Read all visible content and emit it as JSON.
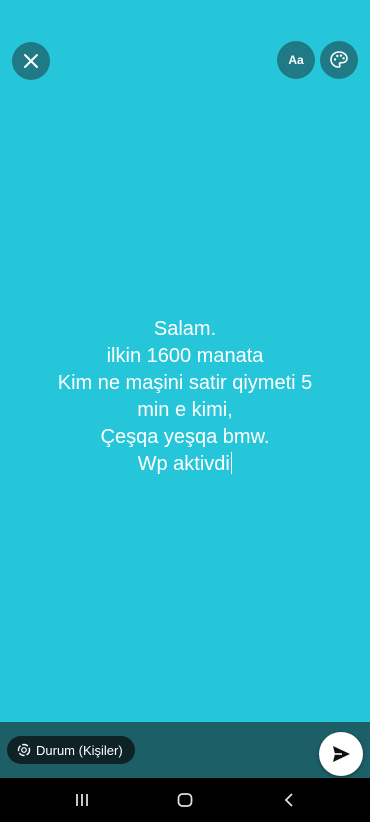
{
  "toolbar": {
    "close_icon": "close-icon",
    "font_button_label": "Aa",
    "palette_icon": "palette-icon"
  },
  "status": {
    "lines": [
      "Salam.",
      "ilkin 1600 manata",
      "Kim ne maşini satir qiymeti 5",
      "min e kimi,",
      "Çeşqa yeşqa bmw.",
      "Wp aktivdi"
    ],
    "background_color": "#26c6da",
    "text_color": "#ffffff"
  },
  "footer": {
    "audience_label": "Durum (Kişiler)",
    "send_icon": "send-icon"
  },
  "nav": {
    "recents_icon": "recents-icon",
    "home_icon": "home-icon",
    "back_icon": "back-icon"
  }
}
